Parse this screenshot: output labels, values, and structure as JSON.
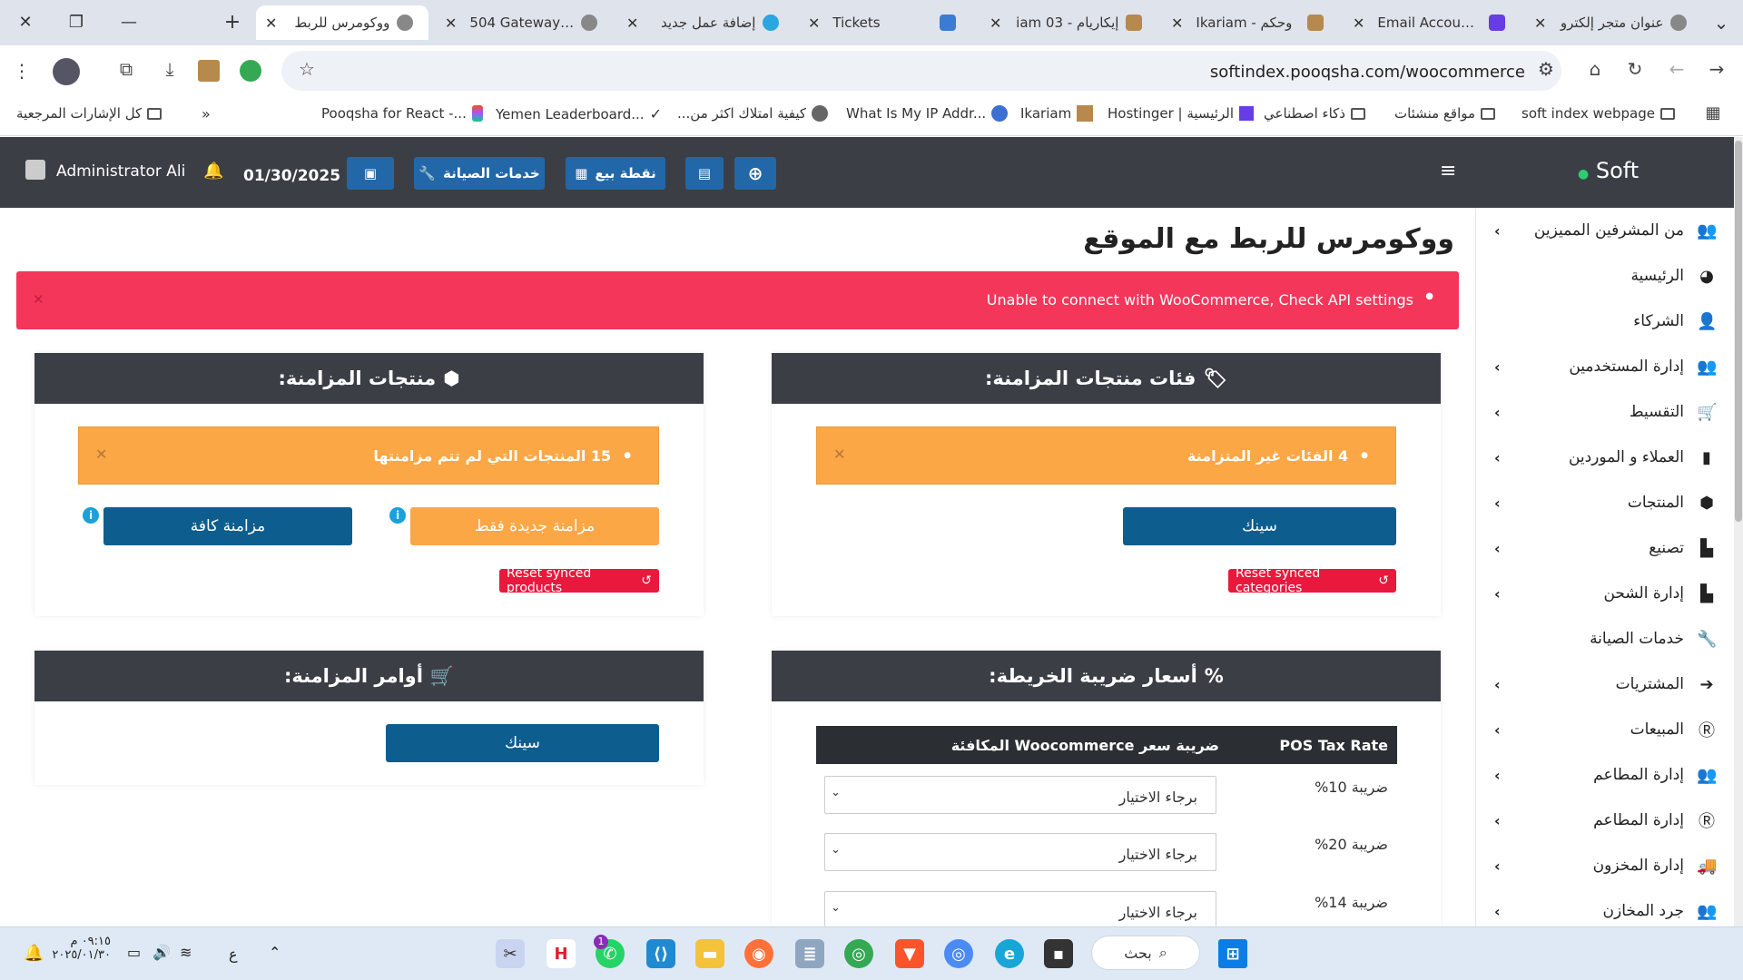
{
  "browser": {
    "tabs": [
      {
        "title": "عنوان متجر إلكترو",
        "favicon": "globe"
      },
      {
        "title": "Email Accounts |",
        "favicon": "hostinger"
      },
      {
        "title": "Ikariam - وحكم",
        "favicon": "ikariam"
      },
      {
        "title": "إيكاريام - iam 03",
        "favicon": "ikariam"
      },
      {
        "title": "Tickets",
        "favicon": "thumbs"
      },
      {
        "title": "إضافة عمل جديد",
        "favicon": "circle"
      },
      {
        "title": "504 Gateway Tim",
        "favicon": "globe"
      },
      {
        "title": "ووكومرس للربط",
        "favicon": "globe",
        "active": true
      }
    ],
    "url": "softindex.pooqsha.com/woocommerce",
    "bookmarks": [
      "soft index webpage",
      "مواقع منشئات",
      "ذكاء اصطناعي",
      "Hostinger | الرئيسية",
      "Ikariam",
      "What Is My IP Addr...",
      "كيفية امتلاك اكثر من...",
      "Yemen Leaderboard...",
      "Pooqsha for React -...",
      "كل الإشارات المرجعية"
    ]
  },
  "appbar": {
    "brand": "Soft",
    "user": "Administrator Ali",
    "date": "01/30/2025",
    "btn_maintenance": "خدمات الصيانة",
    "btn_pos": "نقطة بيع"
  },
  "sidebar": {
    "items": [
      {
        "label": "من المشرفين المميزين",
        "icon": "users-cog-icon",
        "chev": true
      },
      {
        "label": "الرئيسية",
        "icon": "dashboard-icon",
        "chev": false
      },
      {
        "label": "الشركاء",
        "icon": "user-icon",
        "chev": false
      },
      {
        "label": "إدارة المستخدمين",
        "icon": "users-icon",
        "chev": true
      },
      {
        "label": "التقسيط",
        "icon": "cart-icon",
        "chev": true
      },
      {
        "label": "العملاء و الموردين",
        "icon": "address-book-icon",
        "chev": true
      },
      {
        "label": "المنتجات",
        "icon": "cubes-icon",
        "chev": true
      },
      {
        "label": "تصنيع",
        "icon": "industry-icon",
        "chev": true
      },
      {
        "label": "إدارة الشحن",
        "icon": "industry-icon",
        "chev": true
      },
      {
        "label": "خدمات الصيانة",
        "icon": "wrench-icon",
        "chev": false
      },
      {
        "label": "المشتريات",
        "icon": "arrow-circle-icon",
        "chev": true
      },
      {
        "label": "المبيعات",
        "icon": "r-circle-icon",
        "chev": true
      },
      {
        "label": "إدارة المطاعم",
        "icon": "users-cog-icon",
        "chev": true
      },
      {
        "label": "إدارة المطاعم",
        "icon": "r-circle-icon",
        "chev": true
      },
      {
        "label": "إدارة المخزون",
        "icon": "truck-icon",
        "chev": true
      },
      {
        "label": "جرد المخازن",
        "icon": "users-cog-icon",
        "chev": true
      }
    ]
  },
  "page": {
    "title": "ووكومرس للربط مع الموقع",
    "alert": "Unable to connect with WooCommerce, Check API settings"
  },
  "cards": {
    "categories": {
      "title": "فئات منتجات المزامنة:",
      "warning": "4 الفئات غير المتزامنة",
      "sync_btn": "سينك",
      "reset_btn": "Reset synced categories"
    },
    "products": {
      "title": "منتجات المزامنة:",
      "warning": "15 المنتجات التي لم تتم مزامنتها",
      "sync_new_btn": "مزامنة جديدة فقط",
      "sync_all_btn": "مزامنة كافة",
      "reset_btn": "Reset synced products"
    },
    "tax": {
      "title": "أسعار ضريبة الخريطة:",
      "col_pos": "POS Tax Rate",
      "col_woo": "ضريبة سعر Woocommerce المكافئة",
      "rows": [
        {
          "label": "ضريبة 10%",
          "select": "برجاء الاختيار"
        },
        {
          "label": "ضريبة 20%",
          "select": "برجاء الاختيار"
        },
        {
          "label": "ضريبة 14%",
          "select": "برجاء الاختيار"
        }
      ]
    },
    "orders": {
      "title": "أوامر المزامنة:",
      "sync_btn": "سينك"
    }
  },
  "taskbar": {
    "search": "بحث",
    "time": "٠٩:١٥ م",
    "date": "٢٠٢٥/٠١/٣٠",
    "lang": "ع",
    "whatsapp_badge": "1"
  },
  "colors": {
    "alert": "#f3365a",
    "warning": "#fba745",
    "primary": "#0e5d8f",
    "danger": "#e8193d",
    "nav": "#3b3f45"
  }
}
